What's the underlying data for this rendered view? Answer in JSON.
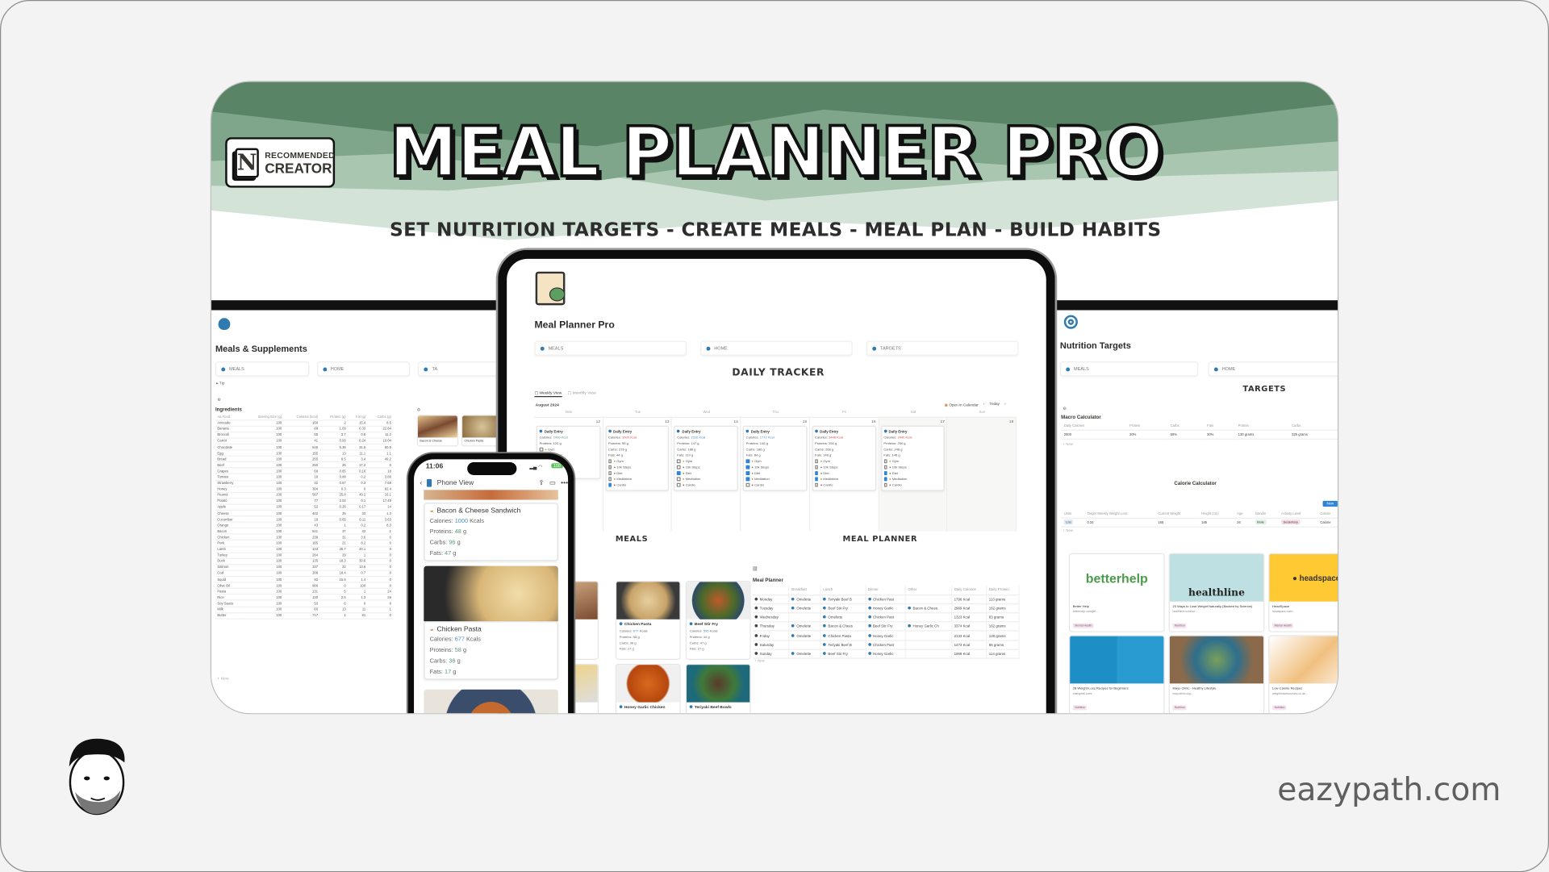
{
  "header": {
    "title": "MEAL PLANNER PRO",
    "subtitle": "SET NUTRITION TARGETS - CREATE MEALS - MEAL PLAN - BUILD HABITS",
    "badge": {
      "logo_letter": "N",
      "line1": "RECOMMENDED",
      "line2": "CREATOR"
    },
    "colors": {
      "dark_green": "#5a8466",
      "mid_green": "#7fa58a",
      "light_green": "#a9c6b1",
      "pale_green": "#d3e3d8"
    }
  },
  "left_panel": {
    "icon": "apple-icon",
    "title": "Meals & Supplements",
    "nav": [
      {
        "label": "MEALS",
        "icon": "apple-icon"
      },
      {
        "label": "HOME",
        "icon": "home-icon"
      },
      {
        "label": "TA",
        "icon": "target-icon"
      }
    ],
    "tip_label": "Tip",
    "table_title": "Ingredients",
    "columns": [
      "Aa Food",
      "Serving Size (g)",
      "Calories (kcal)",
      "Protein (g)",
      "Fat (g)",
      "Carbs (g)"
    ],
    "rows": [
      [
        "Avocado",
        "100",
        "160",
        "2",
        "15.4",
        "8.5"
      ],
      [
        "Banana",
        "100",
        "89",
        "1.09",
        "0.33",
        "22.84"
      ],
      [
        "Broccoli",
        "100",
        "55",
        "3.7",
        "0.6",
        "11.2"
      ],
      [
        "Carrot",
        "100",
        "41",
        "0.93",
        "0.24",
        "10.04"
      ],
      [
        "Chocolate",
        "100",
        "546",
        "5.36",
        "31.6",
        "60.5"
      ],
      [
        "Egg",
        "100",
        "155",
        "13",
        "11.1",
        "1.1"
      ],
      [
        "Bread",
        "100",
        "265",
        "8.5",
        "3.4",
        "49.2"
      ],
      [
        "Beef",
        "100",
        "250",
        "26",
        "17.2",
        "0"
      ],
      [
        "Grapes",
        "100",
        "69",
        "0.65",
        "0.16",
        "18"
      ],
      [
        "Tomato",
        "100",
        "18",
        "0.88",
        "0.2",
        "3.89"
      ],
      [
        "Strawberry",
        "100",
        "32",
        "0.67",
        "0.3",
        "7.68"
      ],
      [
        "Honey",
        "100",
        "304",
        "0.3",
        "0",
        "82.4"
      ],
      [
        "Peanut",
        "100",
        "567",
        "25.8",
        "49.2",
        "16.1"
      ],
      [
        "Potato",
        "100",
        "77",
        "2.02",
        "0.1",
        "17.49"
      ],
      [
        "Apple",
        "100",
        "52",
        "0.26",
        "0.17",
        "14"
      ],
      [
        "Cheese",
        "100",
        "402",
        "25",
        "33",
        "1.3"
      ],
      [
        "Cucumber",
        "100",
        "16",
        "0.65",
        "0.11",
        "3.63"
      ],
      [
        "Orange",
        "100",
        "43",
        "1",
        "0.2",
        "8.3"
      ],
      [
        "Bacon",
        "100",
        "541",
        "37",
        "42",
        "1"
      ],
      [
        "Chicken",
        "100",
        "239",
        "31",
        "3.6",
        "0"
      ],
      [
        "Pork",
        "100",
        "165",
        "21",
        "8.2",
        "0"
      ],
      [
        "Lamb",
        "100",
        "143",
        "25.7",
        "20.1",
        "0"
      ],
      [
        "Turkey",
        "100",
        "264",
        "29",
        "1",
        "0"
      ],
      [
        "Duck",
        "100",
        "135",
        "18.3",
        "30.6",
        "0"
      ],
      [
        "Salmon",
        "100",
        "337",
        "22",
        "13.6",
        "0"
      ],
      [
        "Cod",
        "100",
        "206",
        "18.4",
        "0.7",
        "0"
      ],
      [
        "Squid",
        "100",
        "92",
        "15.6",
        "1.4",
        "0"
      ],
      [
        "Olive Oil",
        "100",
        "900",
        "0",
        "100",
        "0"
      ],
      [
        "Pasta",
        "100",
        "131",
        "5",
        "1",
        "24"
      ],
      [
        "Rice",
        "100",
        "130",
        "2.5",
        "1.3",
        "28"
      ],
      [
        "Soy Sauce",
        "100",
        "53",
        "6",
        "0",
        "8"
      ],
      [
        "Milk",
        "100",
        "60",
        "13",
        "11",
        "1"
      ],
      [
        "Butter",
        "100",
        "717",
        "1",
        "81",
        "0"
      ]
    ],
    "new_label": "+ New",
    "gallery": [
      "Bacon & Cheese",
      "Chicken Pasta"
    ]
  },
  "tablet": {
    "title": "Meal Planner Pro",
    "nav": [
      {
        "label": "MEALS",
        "icon": "apple-icon"
      },
      {
        "label": "HOME",
        "icon": "home-icon"
      },
      {
        "label": "TARGETS",
        "icon": "target-icon"
      }
    ],
    "tracker_heading": "DAILY TRACKER",
    "views": [
      "Weekly View",
      "Monthly View"
    ],
    "month": "August 2024",
    "open_calendar": "Open in Calendar",
    "today": "Today",
    "weekdays": [
      "Mon",
      "Tue",
      "Wed",
      "Thu",
      "Fri",
      "Sat",
      "Sun"
    ],
    "days": [
      {
        "date": "12",
        "entry": {
          "title": "Daily Entry",
          "calories": "2400 Kcal",
          "cal_status": "green",
          "proteins": "120 g",
          "habits": [
            false,
            false,
            false,
            false,
            true
          ]
        }
      },
      {
        "date": "13",
        "entry": {
          "title": "Daily Entry",
          "calories": "3000 Kcal",
          "cal_status": "red",
          "proteins": "98 g",
          "carbs": "276 g",
          "fats": "44 g",
          "habits": [
            false,
            false,
            false,
            false,
            true
          ]
        }
      },
      {
        "date": "14",
        "entry": {
          "title": "Daily Entry",
          "calories": "2316 Kcal",
          "cal_status": "blue",
          "proteins": "147 g",
          "carbs": "188 g",
          "fats": "110 g",
          "habits": [
            false,
            false,
            true,
            false,
            false
          ]
        }
      },
      {
        "date": "15",
        "entry": {
          "title": "Daily Entry",
          "calories": "1772 Kcal",
          "cal_status": "blue",
          "proteins": "146 g",
          "carbs": "186 g",
          "fats": "84 g",
          "habits": [
            true,
            true,
            true,
            true,
            false
          ]
        }
      },
      {
        "date": "16",
        "entry": {
          "title": "Daily Entry",
          "calories": "3448 Kcal",
          "cal_status": "red",
          "proteins": "250 g",
          "carbs": "268 g",
          "fats": "148 g",
          "habits": [
            false,
            false,
            true,
            true,
            false
          ]
        }
      },
      {
        "date": "17",
        "entry": {
          "title": "Daily Entry",
          "calories": "3440 Kcal",
          "cal_status": "red",
          "proteins": "250 g",
          "carbs": "248 g",
          "fats": "148 g",
          "habits": [
            false,
            false,
            true,
            true,
            false
          ]
        }
      },
      {
        "date": "18"
      }
    ],
    "habit_labels": [
      "Gym",
      "10k Steps",
      "Diet",
      "Meditation",
      "Cardio"
    ],
    "entry_labels": {
      "calories": "Calories:",
      "proteins": "Proteins:",
      "carbs": "Carbs:",
      "fats": "Fats:"
    },
    "meals_heading": "MEALS",
    "planner_heading": "MEAL PLANNER",
    "meals": [
      {
        "name": "andwich"
      },
      {
        "name": "Chicken Pasta",
        "calories": "677",
        "proteins": "58",
        "carbs": "36",
        "fats": "17"
      },
      {
        "name": "Beef Stir Fry",
        "calories": "595",
        "proteins": "44",
        "carbs": "47",
        "fats": "27"
      },
      {
        "name": ""
      },
      {
        "name": "Honey Garlic Chicken"
      },
      {
        "name": "Teriyaki Beef Bowls"
      }
    ],
    "planner": {
      "title": "Meal Planner",
      "columns": [
        "",
        "Breakfast",
        "Lunch",
        "Dinner",
        "Other",
        "Daily Calories",
        "Daily Protein"
      ],
      "rows": [
        [
          "Monday",
          "Omelette",
          "Teriyaki Beef B",
          "Chicken Past",
          "",
          "1796 Kcal",
          "113 grams"
        ],
        [
          "Tuesday",
          "Omelette",
          "Beef Stir Fry",
          "Honey Garlic",
          "Bacon & Chees",
          "2969 Kcal",
          "162 grams"
        ],
        [
          "Wednesday",
          "",
          "Omelette",
          "Chicken Past",
          "",
          "1323 Kcal",
          "83 grams"
        ],
        [
          "Thursday",
          "Omelette",
          "Bacon & Chees",
          "Beef Stir Fry",
          "Honey Garlic Ch",
          "3374 Kcal",
          "162 grams"
        ],
        [
          "Friday",
          "Omelette",
          "Chicken Pasta",
          "Honey Garlic",
          "",
          "2133 Kcal",
          "128 grams"
        ],
        [
          "Saturday",
          "",
          "Teriyaki Beef B",
          "Chicken Past",
          "",
          "1473 Kcal",
          "88 grams"
        ],
        [
          "Sunday",
          "Omelette",
          "Beef Stir Fry",
          "Honey Garlic",
          "",
          "1969 Kcal",
          "114 grams"
        ]
      ],
      "new_label": "+ New"
    }
  },
  "phone": {
    "time": "11:06",
    "battery": "100",
    "page_title": "Phone View",
    "labels": {
      "calories": "Calories:",
      "kcals": "Kcals",
      "proteins": "Proteins:",
      "carbs": "Carbs:",
      "fats": "Fats:",
      "g": "g"
    },
    "cards": [
      {
        "name": "Bacon & Cheese Sandwich",
        "calories": "1000",
        "proteins": "48",
        "carbs": "96",
        "fats": "47"
      },
      {
        "name": "Chicken Pasta",
        "calories": "677",
        "proteins": "58",
        "carbs": "36",
        "fats": "17"
      }
    ]
  },
  "right_panel": {
    "icon": "target-icon",
    "title": "Nutrition Targets",
    "nav": [
      {
        "label": "MEALS",
        "icon": "apple-icon"
      },
      {
        "label": "HOME",
        "icon": "home-icon"
      }
    ],
    "targets_heading": "TARGETS",
    "macro": {
      "title": "Macro Calculator",
      "columns": [
        "Daily Calories",
        "Protein",
        "Carbs",
        "Fats",
        "Protein",
        "Carbs"
      ],
      "values": [
        "2600",
        "20%",
        "50%",
        "30%",
        "130 grams",
        "325 grams"
      ],
      "new_label": "+ New"
    },
    "calorie": {
      "title": "Calorie Calculator",
      "new_button": "New",
      "columns": [
        "Units",
        "Target Weekly Weight Loss",
        "Current Weight",
        "Height (cm)",
        "Age",
        "Gender",
        "Activity Level",
        "Calorie"
      ],
      "values": [
        "Lbs",
        "0.34",
        "165",
        "185",
        "26",
        "Male",
        "Sedentary",
        "Calorie"
      ],
      "new_label": "+ New"
    },
    "resources": [
      {
        "logo": "betterhelp",
        "title": "Better Help",
        "url": "betterhelp.com/get...",
        "tag": "Mental Health"
      },
      {
        "logo": "healthline",
        "title": "20 Ways to Lose Weight Naturally (Backed by Science)",
        "url": "healthline.com/nut...",
        "tag": "Nutrition"
      },
      {
        "logo": "headspace",
        "title": "HeadSpace",
        "url": "headspace.com/...",
        "tag": "Mental Health"
      },
      {
        "logo": "",
        "title": "28 Weight-Loss Recipes for Beginners",
        "url": "eatingwell.com/...",
        "tag": "Nutrition"
      },
      {
        "logo": "",
        "title": "Mayo Clinic - Healthy Lifestyle",
        "url": "mayoclinic.org/...",
        "tag": "Nutrition"
      },
      {
        "logo": "",
        "title": "Low Calorie Recipes",
        "url": "weightlossresources.co.uk/...",
        "tag": "Nutrition"
      }
    ]
  },
  "footer": {
    "site": "eazypath.com"
  }
}
